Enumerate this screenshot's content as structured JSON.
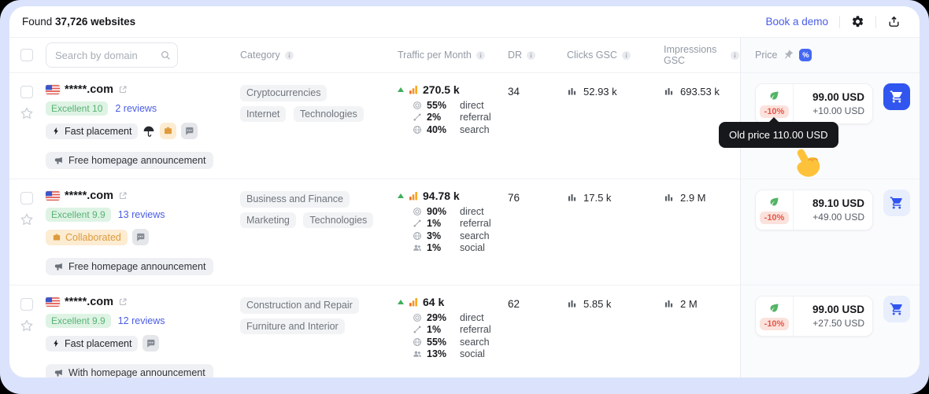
{
  "colors": {
    "accent_blue": "#3155ef",
    "link_blue": "#4a5ce5",
    "success_green": "#57b273",
    "warning_orange": "#dd9b3e",
    "danger_red": "#e4574b",
    "tooltip_bg": "#17181b",
    "traffic_bar_orange": "#f7941e"
  },
  "topbar": {
    "found_prefix": "Found",
    "found_count": "37,726 websites",
    "book_demo": "Book a demo"
  },
  "thead": {
    "search_placeholder": "Search by domain",
    "category": "Category",
    "traffic": "Traffic per Month",
    "dr": "DR",
    "clicks": "Clicks GSC",
    "impressions": "Impressions GSC",
    "price": "Price",
    "discount_icon": "%"
  },
  "tooltip": {
    "text": "Old price 110.00 USD"
  },
  "rows": [
    {
      "domain": "*****.com",
      "rating": "Excellent 10",
      "reviews": "2 reviews",
      "fast_placement": "Fast placement",
      "announcement": "Free homepage announcement",
      "categories": [
        "Cryptocurrencies",
        "Internet",
        "Technologies"
      ],
      "traffic": "270.5 k",
      "breakdown": [
        {
          "pct": "55%",
          "label": "direct"
        },
        {
          "pct": "2%",
          "label": "referral"
        },
        {
          "pct": "40%",
          "label": "search"
        }
      ],
      "dr": "34",
      "clicks": "52.93 k",
      "impressions": "693.53 k",
      "discount": "-10%",
      "price": "99.00 USD",
      "price_extra": "+10.00 USD"
    },
    {
      "domain": "*****.com",
      "rating": "Excellent 9.9",
      "reviews": "13 reviews",
      "collaborated": "Collaborated",
      "announcement": "Free homepage announcement",
      "categories": [
        "Business and Finance",
        "Marketing",
        "Technologies"
      ],
      "traffic": "94.78 k",
      "breakdown": [
        {
          "pct": "90%",
          "label": "direct"
        },
        {
          "pct": "1%",
          "label": "referral"
        },
        {
          "pct": "3%",
          "label": "search"
        },
        {
          "pct": "1%",
          "label": "social"
        }
      ],
      "dr": "76",
      "clicks": "17.5 k",
      "impressions": "2.9 M",
      "discount": "-10%",
      "price": "89.10 USD",
      "price_extra": "+49.00 USD"
    },
    {
      "domain": "*****.com",
      "rating": "Excellent 9.9",
      "reviews": "12 reviews",
      "fast_placement": "Fast placement",
      "announcement": "With homepage announcement",
      "categories": [
        "Construction and Repair",
        "Furniture and Interior"
      ],
      "traffic": "64 k",
      "breakdown": [
        {
          "pct": "29%",
          "label": "direct"
        },
        {
          "pct": "1%",
          "label": "referral"
        },
        {
          "pct": "55%",
          "label": "search"
        },
        {
          "pct": "13%",
          "label": "social"
        }
      ],
      "dr": "62",
      "clicks": "5.85 k",
      "impressions": "2 M",
      "discount": "-10%",
      "price": "99.00 USD",
      "price_extra": "+27.50 USD"
    }
  ]
}
